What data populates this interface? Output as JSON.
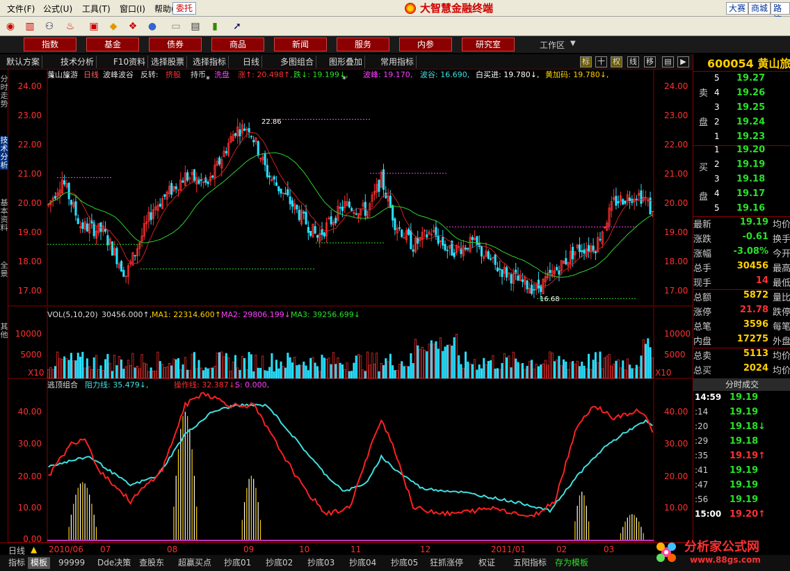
{
  "menu": {
    "items": [
      "文件(F)",
      "公式(U)",
      "工具(T)",
      "窗口(I)",
      "帮助(H)"
    ],
    "weituo": "委托"
  },
  "brand": {
    "title": "大智慧金融终端"
  },
  "top_links": [
    "大赛",
    "商城",
    "路演"
  ],
  "nav": {
    "buttons": [
      "指数",
      "基金",
      "债券",
      "商品",
      "新闻",
      "服务",
      "内参",
      "研究室"
    ],
    "workarea": "工作区"
  },
  "tabs": {
    "items": [
      "默认方案",
      "技术分析",
      "F10资料",
      "选择股票",
      "选择指标",
      "日线",
      "多图组合",
      "图形叠加",
      "常用指标"
    ],
    "right_icons": [
      "标",
      "十",
      "权",
      "线",
      "移"
    ]
  },
  "left_tabs": [
    "分时走势",
    "技术分析",
    "基本资料",
    "全景",
    "其他"
  ],
  "price_header": {
    "name": "黄山旅游",
    "period": "日线",
    "indicator": "波峰波谷",
    "reversal": "反转:",
    "mark1": "挤股",
    "hold": "持币",
    "wash": "洗盘",
    "rise_label": "涨↑: 20.498↑,",
    "fall_label": "跌↓: 19.199↓,",
    "peak_label": "波峰: 19.170,",
    "valley_label": "波谷: 16.690,",
    "white_buy": "白买进: 19.780↓,",
    "yellow_buy": "黄加码: 19.780↓,"
  },
  "price_axis": [
    "24.00",
    "23.00",
    "22.00",
    "21.00",
    "20.00",
    "19.00",
    "18.00",
    "17.00"
  ],
  "price_marks": {
    "high": "22.86",
    "low": "16.68"
  },
  "volume": {
    "header": "VOL(5,10,20)",
    "vol": "30456.000↑,",
    "ma1": "MA1: 22314.600↑,",
    "ma2": "MA2: 29806.199↓,",
    "ma3": "MA3: 39256.699↓",
    "axis": [
      "10000",
      "5000"
    ],
    "unit": "X10"
  },
  "indicator": {
    "name": "逃顶组合",
    "resist": "阻力线: 35.479↓,",
    "op": "操作线: 32.387↓,",
    "s": "S: 0.000,",
    "axis": [
      "40.00",
      "30.00",
      "20.00",
      "10.00",
      "0.00"
    ]
  },
  "x_axis": [
    "2010/06",
    "07",
    "08",
    "09",
    "10",
    "11",
    "12",
    "2011/01",
    "02",
    "03"
  ],
  "quote": {
    "code": "600054",
    "name": "黄山旅",
    "sell_label": [
      "卖",
      "盘"
    ],
    "buy_label": [
      "买",
      "盘"
    ],
    "sell": [
      {
        "n": "5",
        "p": "19.27"
      },
      {
        "n": "4",
        "p": "19.26"
      },
      {
        "n": "3",
        "p": "19.25"
      },
      {
        "n": "2",
        "p": "19.24"
      },
      {
        "n": "1",
        "p": "19.23"
      }
    ],
    "buy": [
      {
        "n": "1",
        "p": "19.20"
      },
      {
        "n": "2",
        "p": "19.19"
      },
      {
        "n": "3",
        "p": "19.18"
      },
      {
        "n": "4",
        "p": "19.17"
      },
      {
        "n": "5",
        "p": "19.16"
      }
    ],
    "stats": [
      {
        "l": "最新",
        "v": "19.19",
        "c": "#28e028",
        "r": "均价"
      },
      {
        "l": "涨跌",
        "v": "-0.61",
        "c": "#28e028",
        "r": "换手"
      },
      {
        "l": "涨幅",
        "v": "-3.08%",
        "c": "#28e028",
        "r": "今开"
      },
      {
        "l": "总手",
        "v": "30456",
        "c": "#ffd000",
        "r": "最高"
      },
      {
        "l": "现手",
        "v": "14",
        "c": "#ff3030",
        "r": "最低"
      },
      {
        "l": "总额",
        "v": "5872",
        "c": "#ffd000",
        "r": "量比"
      },
      {
        "l": "涨停",
        "v": "21.78",
        "c": "#ff3030",
        "r": "跌停"
      },
      {
        "l": "总笔",
        "v": "3596",
        "c": "#ffd000",
        "r": "每笔"
      },
      {
        "l": "内盘",
        "v": "17275",
        "c": "#ffd000",
        "r": "外盘"
      },
      {
        "l": "总卖",
        "v": "5113",
        "c": "#ffd000",
        "r": "均价"
      },
      {
        "l": "总买",
        "v": "2024",
        "c": "#ffd000",
        "r": "均价"
      }
    ],
    "ticks_header": "分时成交",
    "ticks": [
      {
        "t": "14:59",
        "p": "19.19",
        "a": ""
      },
      {
        "t": ":14",
        "p": "19.19",
        "a": ""
      },
      {
        "t": ":20",
        "p": "19.18",
        "a": "↓"
      },
      {
        "t": ":29",
        "p": "19.18",
        "a": ""
      },
      {
        "t": ":35",
        "p": "19.19",
        "a": "↑"
      },
      {
        "t": ":41",
        "p": "19.19",
        "a": ""
      },
      {
        "t": ":47",
        "p": "19.19",
        "a": ""
      },
      {
        "t": ":56",
        "p": "19.19",
        "a": ""
      },
      {
        "t": "15:00",
        "p": "19.20",
        "a": "↑"
      }
    ]
  },
  "bottom": {
    "period": "日线",
    "tabs": [
      "指标",
      "模板",
      "99999",
      "Dde决策",
      "查股东",
      "超赢买点",
      "抄底01",
      "抄底02",
      "抄底03",
      "抄底04",
      "抄底05",
      "狂抓涨停",
      "权证",
      "五阳指标",
      "存为模板"
    ]
  },
  "watermark": {
    "text": "分析家公式网",
    "url": "www.88gs.com"
  },
  "colors": {
    "up": "#ff3030",
    "down": "#28e0ff",
    "resist": "#ff2020",
    "op": "#40e0e0",
    "ma_red": "#d02020",
    "ma_green": "#30d030",
    "grid": "#7a0000",
    "panel_bg": "#000000"
  }
}
